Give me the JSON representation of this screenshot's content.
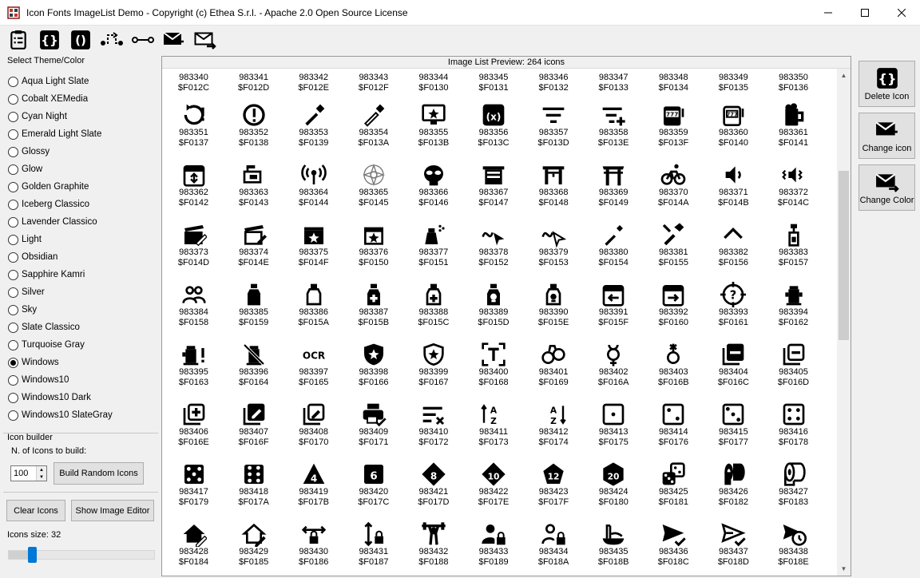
{
  "window": {
    "title": "Icon Fonts ImageList Demo - Copyright (c) Ethea S.r.l. - Apache 2.0 Open Source License",
    "minimize": "─",
    "maximize": "☐",
    "close": "✕"
  },
  "toolbar": {
    "buttons": [
      {
        "icon": "clipboard-list-icon"
      },
      {
        "icon": "code-braces-box-icon"
      },
      {
        "icon": "code-parentheses-box-icon"
      },
      {
        "icon": "source-branch-icon"
      },
      {
        "icon": "source-commit-icon"
      },
      {
        "icon": "email-receive-icon"
      },
      {
        "icon": "email-send-icon"
      }
    ]
  },
  "theme": {
    "label": "Select Theme/Color",
    "selected": "Windows",
    "options": [
      "Aqua Light Slate",
      "Cobalt XEMedia",
      "Cyan Night",
      "Emerald Light Slate",
      "Glossy",
      "Glow",
      "Golden Graphite",
      "Iceberg Classico",
      "Lavender Classico",
      "Light",
      "Obsidian",
      "Sapphire Kamri",
      "Silver",
      "Sky",
      "Slate Classico",
      "Turquoise Gray",
      "Windows",
      "Windows10",
      "Windows10 Dark",
      "Windows10 SlateGray"
    ]
  },
  "builder": {
    "group_label": "Icon builder",
    "count_label": "N. of Icons to build:",
    "count_value": "100",
    "build_button": "Build Random Icons",
    "clear_button": "Clear Icons",
    "editor_button": "Show Image Editor",
    "size_label": "Icons size: 32",
    "size_value": 32
  },
  "preview": {
    "header": "Image List Preview: 264 icons",
    "top_row": [
      [
        "983340",
        "$F012C"
      ],
      [
        "983341",
        "$F012D"
      ],
      [
        "983342",
        "$F012E"
      ],
      [
        "983343",
        "$F012F"
      ],
      [
        "983344",
        "$F0130"
      ],
      [
        "983345",
        "$F0131"
      ],
      [
        "983346",
        "$F0132"
      ],
      [
        "983347",
        "$F0133"
      ],
      [
        "983348",
        "$F0134"
      ],
      [
        "983349",
        "$F0135"
      ],
      [
        "983350",
        "$F0136"
      ]
    ],
    "rows": [
      [
        [
          "983351",
          "$F0137",
          "sync-alert"
        ],
        [
          "983352",
          "$F0138",
          "clock-alert"
        ],
        [
          "983353",
          "$F0139",
          "eyedropper"
        ],
        [
          "983354",
          "$F013A",
          "eyedropper-variant"
        ],
        [
          "983355",
          "$F013B",
          "monitor-star"
        ],
        [
          "983356",
          "$F013C",
          "variable-box"
        ],
        [
          "983357",
          "$F013D",
          "filter-lines"
        ],
        [
          "983358",
          "$F013E",
          "filter-plus"
        ],
        [
          "983359",
          "$F013F",
          "slot-machine"
        ],
        [
          "983360",
          "$F0140",
          "slot-machine-outline"
        ],
        [
          "983361",
          "$F0141",
          "glass-mug"
        ]
      ],
      [
        [
          "983362",
          "$F0142",
          "calendar-sync"
        ],
        [
          "983363",
          "$F0143",
          "mailbox"
        ],
        [
          "983364",
          "$F0144",
          "access-point"
        ],
        [
          "983365",
          "$F0145",
          "mandala"
        ],
        [
          "983366",
          "$F0146",
          "alien"
        ],
        [
          "983367",
          "$F0147",
          "gate"
        ],
        [
          "983368",
          "$F0148",
          "gate-outline"
        ],
        [
          "983369",
          "$F0149",
          "torii"
        ],
        [
          "983370",
          "$F014A",
          "bike"
        ],
        [
          "983371",
          "$F014B",
          "volume-low"
        ],
        [
          "983372",
          "$F014C",
          "volume-vibrate"
        ]
      ],
      [
        [
          "983373",
          "$F014D",
          "movie-edit"
        ],
        [
          "983374",
          "$F014E",
          "movie-edit-outline"
        ],
        [
          "983375",
          "$F014F",
          "movie-star"
        ],
        [
          "983376",
          "$F0150",
          "movie-star-outline"
        ],
        [
          "983377",
          "$F0151",
          "spray"
        ],
        [
          "983378",
          "$F0152",
          "draw-cursor"
        ],
        [
          "983379",
          "$F0153",
          "draw-cursor-outline"
        ],
        [
          "983380",
          "$F0154",
          "toothbrush"
        ],
        [
          "983381",
          "$F0155",
          "toothbrush-paste"
        ],
        [
          "983382",
          "$F0156",
          "chevron-up"
        ],
        [
          "983383",
          "$F0157",
          "pipe-valve"
        ]
      ],
      [
        [
          "983384",
          "$F0158",
          "account-group"
        ],
        [
          "983385",
          "$F0159",
          "bottle"
        ],
        [
          "983386",
          "$F015A",
          "bottle-outline"
        ],
        [
          "983387",
          "$F015B",
          "medical-bottle"
        ],
        [
          "983388",
          "$F015C",
          "medical-bottle-outline"
        ],
        [
          "983389",
          "$F015D",
          "poison-bottle"
        ],
        [
          "983390",
          "$F015E",
          "poison-bottle-outline"
        ],
        [
          "983391",
          "$F015F",
          "calendar-arrow-left"
        ],
        [
          "983392",
          "$F0160",
          "calendar-arrow-right"
        ],
        [
          "983393",
          "$F0161",
          "help-target"
        ],
        [
          "983394",
          "$F0162",
          "fire-hydrant"
        ]
      ],
      [
        [
          "983395",
          "$F0163",
          "fire-hydrant-alert"
        ],
        [
          "983396",
          "$F0164",
          "fire-hydrant-off"
        ],
        [
          "983397",
          "$F0165",
          "ocr"
        ],
        [
          "983398",
          "$F0166",
          "shield-star"
        ],
        [
          "983399",
          "$F0167",
          "shield-star-outline"
        ],
        [
          "983400",
          "$F0168",
          "text-recognition"
        ],
        [
          "983401",
          "$F0169",
          "handcuffs"
        ],
        [
          "983402",
          "$F016A",
          "gender-male-female"
        ],
        [
          "983403",
          "$F016B",
          "gender-non-binary"
        ],
        [
          "983404",
          "$F016C",
          "minus-box-multiple"
        ],
        [
          "983405",
          "$F016D",
          "minus-box-multiple-outline"
        ]
      ],
      [
        [
          "983406",
          "$F016E",
          "plus-box-multiple"
        ],
        [
          "983407",
          "$F016F",
          "pencil-box-multiple"
        ],
        [
          "983408",
          "$F0170",
          "pencil-box-multiple-outline"
        ],
        [
          "983409",
          "$F0171",
          "printer-check"
        ],
        [
          "983410",
          "$F0172",
          "sort-variant-remove"
        ],
        [
          "983411",
          "$F0173",
          "sort-alphabetical-ascending"
        ],
        [
          "983412",
          "$F0174",
          "sort-alphabetical-descending"
        ],
        [
          "983413",
          "$F0175",
          "dice-1"
        ],
        [
          "983414",
          "$F0176",
          "dice-2"
        ],
        [
          "983415",
          "$F0177",
          "dice-3"
        ],
        [
          "983416",
          "$F0178",
          "dice-4"
        ]
      ],
      [
        [
          "983417",
          "$F0179",
          "dice-5"
        ],
        [
          "983418",
          "$F017A",
          "dice-6"
        ],
        [
          "983419",
          "$F017B",
          "dice-d4"
        ],
        [
          "983420",
          "$F017C",
          "dice-d6"
        ],
        [
          "983421",
          "$F017D",
          "dice-d8"
        ],
        [
          "983422",
          "$F017E",
          "dice-d10"
        ],
        [
          "983423",
          "$F017F",
          "dice-d12"
        ],
        [
          "983424",
          "$F0180",
          "dice-d20"
        ],
        [
          "983425",
          "$F0181",
          "dice-multiple"
        ],
        [
          "983426",
          "$F0182",
          "paper-roll"
        ],
        [
          "983427",
          "$F0183",
          "paper-roll-outline"
        ]
      ],
      [
        [
          "983428",
          "$F0184",
          "home-edit"
        ],
        [
          "983429",
          "$F0185",
          "home-edit-outline"
        ],
        [
          "983430",
          "$F0186",
          "arrow-horizontal-lock"
        ],
        [
          "983431",
          "$F0187",
          "arrow-vertical-lock"
        ],
        [
          "983432",
          "$F0188",
          "weight-lifter"
        ],
        [
          "983433",
          "$F0189",
          "account-lock"
        ],
        [
          "983434",
          "$F018A",
          "account-lock-outline"
        ],
        [
          "983435",
          "$F018B",
          "pasta"
        ],
        [
          "983436",
          "$F018C",
          "send-check"
        ],
        [
          "983437",
          "$F018D",
          "send-check-outline"
        ],
        [
          "983438",
          "$F018E",
          "send-clock"
        ]
      ]
    ]
  },
  "actions": [
    {
      "label": "Delete Icon",
      "icon": "code-braces-box-icon"
    },
    {
      "label": "Change icon",
      "icon": "email-receive-icon"
    },
    {
      "label": "Change Color",
      "icon": "email-send-icon"
    }
  ]
}
